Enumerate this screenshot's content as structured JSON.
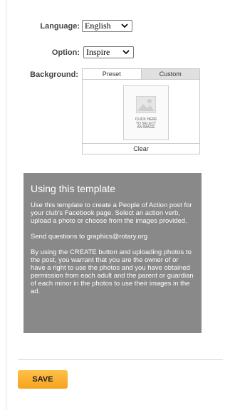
{
  "language": {
    "label": "Language:",
    "value": "English"
  },
  "option": {
    "label": "Option:",
    "value": "Inspire"
  },
  "background": {
    "label": "Background:",
    "tabs": [
      "Preset",
      "Custom"
    ],
    "selected_tab": "Preset",
    "placeholder_text": "CLICK HERE\nTO SELECT\nAN IMAGE",
    "clear_label": "Clear"
  },
  "info": {
    "title": "Using this template",
    "paragraphs": [
      "Use this template to create a People of Action post for your club's Facebook page. Select an action verb, upload a photo or choose from the images provided.",
      "Send questions to graphics@rotary.org",
      "By using the CREATE button and uploading photos to the post, you warrant that you are the owner of or have a right to use the photos and you have obtained permission from each adult and the parent or guardian of each minor in the photos to use their images in the ad."
    ]
  },
  "save_label": "SAVE",
  "colors": {
    "info_bg": "#898989",
    "save_bg": "#f7a21e"
  }
}
